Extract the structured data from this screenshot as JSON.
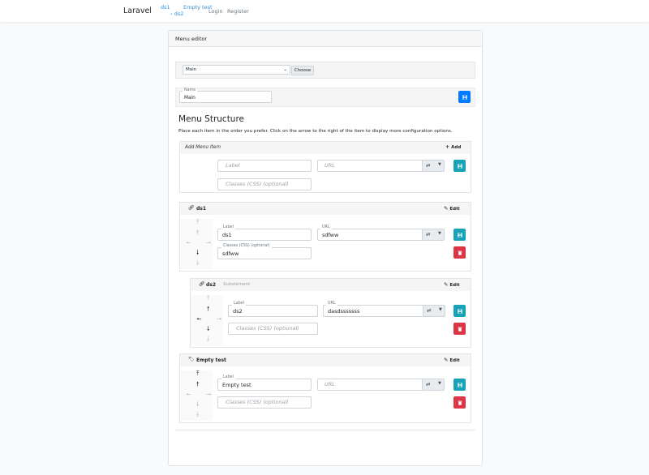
{
  "nav": {
    "brand": "Laravel",
    "links": {
      "ds1": "ds1",
      "ds2": "ds2",
      "empty_test": "Empty test",
      "login": "Login",
      "register": "Register"
    }
  },
  "editor": {
    "title": "Menu editor",
    "select": {
      "value": "Main",
      "choose_label": "Choose"
    },
    "name": {
      "label": "Name",
      "value": "Main"
    },
    "structure_heading": "Menu Structure",
    "structure_help": "Place each item in the order you prefer. Click on the arrow to the right of the item to display more configuration options.",
    "add_panel": {
      "title": "Add Menu item",
      "add_label": "Add",
      "label_ph": "Label",
      "url_ph": "URL",
      "classes_ph": "Classes (CSS) (optional)"
    },
    "items": [
      {
        "title": "ds1",
        "subtitle": "",
        "edit": "Edit",
        "label_caption": "Label",
        "label_value": "ds1",
        "url_caption": "URL",
        "url_value": "sdfww",
        "classes_caption": "Classes (CSS) (optional)",
        "classes_value": "sdfww"
      },
      {
        "title": "ds2",
        "subtitle": "Subelement",
        "edit": "Edit",
        "label_caption": "Label",
        "label_value": "ds2",
        "url_caption": "URL",
        "url_value": "dasdsssssss",
        "classes_ph": "Classes (CSS) (optional)"
      },
      {
        "title": "Empty test",
        "subtitle": "",
        "edit": "Edit",
        "label_caption": "Label",
        "label_value": "Empty test",
        "url_ph": "URL",
        "classes_ph": "Classes (CSS) (optional)"
      }
    ]
  },
  "glyphs": {
    "swap": "⇄",
    "caret": "▼"
  },
  "colors": {
    "primary": "#007bff",
    "info": "#17a2b8",
    "danger": "#dc3545",
    "link": "#3490dc"
  }
}
